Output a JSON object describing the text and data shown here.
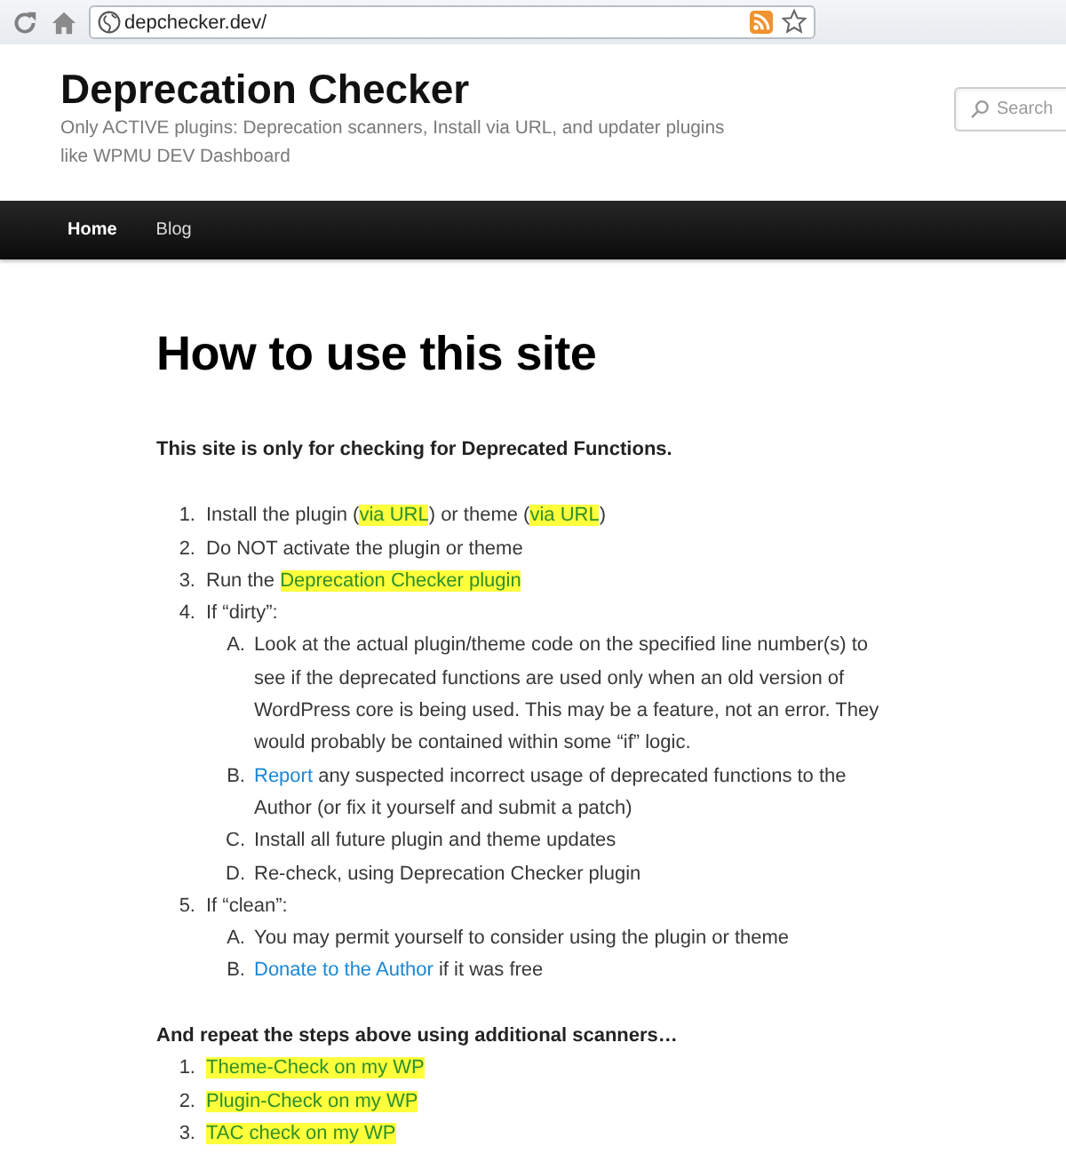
{
  "browser": {
    "url": "depchecker.dev/"
  },
  "header": {
    "site_title": "Deprecation Checker",
    "tagline": "Only ACTIVE plugins: Deprecation scanners, Install via URL, and updater plugins like WPMU DEV Dashboard",
    "search": {
      "placeholder": "Search"
    }
  },
  "nav": [
    {
      "label": "Home",
      "selected": true
    },
    {
      "label": "Blog",
      "selected": false
    }
  ],
  "article": {
    "title": "How to use this site",
    "intro": "This site is only for checking for Deprecated Functions.",
    "steps": [
      {
        "marker": "1.",
        "parts": [
          {
            "kind": "text",
            "text": "Install the plugin ("
          },
          {
            "kind": "highlighted-link",
            "text": "via URL"
          },
          {
            "kind": "text",
            "text": ") or theme ("
          },
          {
            "kind": "highlighted-link",
            "text": "via URL"
          },
          {
            "kind": "text",
            "text": ")"
          }
        ]
      },
      {
        "marker": "2.",
        "parts": [
          {
            "kind": "text",
            "text": "Do NOT activate the plugin or theme"
          }
        ]
      },
      {
        "marker": "3.",
        "parts": [
          {
            "kind": "text",
            "text": "Run the "
          },
          {
            "kind": "highlighted-link",
            "text": "Deprecation Checker plugin"
          }
        ]
      },
      {
        "marker": "4.",
        "parts": [
          {
            "kind": "text",
            "text": "If “dirty”:"
          }
        ],
        "children": [
          {
            "marker": "A.",
            "parts": [
              {
                "kind": "text",
                "text": "Look at the actual plugin/theme code on the specified line number(s) to see if the deprecated functions are used only when an old version of WordPress core is being used. This may be a feature, not an error. They would probably be contained within some “if” logic."
              }
            ]
          },
          {
            "marker": "B.",
            "parts": [
              {
                "kind": "link",
                "text": "Report"
              },
              {
                "kind": "text",
                "text": " any suspected incorrect usage of deprecated functions to the Author (or fix it yourself and submit a patch)"
              }
            ]
          },
          {
            "marker": "C.",
            "parts": [
              {
                "kind": "text",
                "text": "Install all future plugin and theme updates"
              }
            ]
          },
          {
            "marker": "D.",
            "parts": [
              {
                "kind": "text",
                "text": "Re-check, using Deprecation Checker plugin"
              }
            ]
          }
        ]
      },
      {
        "marker": "5.",
        "parts": [
          {
            "kind": "text",
            "text": "If “clean”:"
          }
        ],
        "children": [
          {
            "marker": "A.",
            "parts": [
              {
                "kind": "text",
                "text": "You may permit yourself to consider using the plugin or theme"
              }
            ]
          },
          {
            "marker": "B.",
            "parts": [
              {
                "kind": "link",
                "text": "Donate to the Author"
              },
              {
                "kind": "text",
                "text": " if it was free"
              }
            ]
          }
        ]
      }
    ],
    "more_heading": "And repeat the steps above using additional scanners…",
    "scanners": [
      {
        "marker": "1.",
        "parts": [
          {
            "kind": "highlighted-link",
            "text": "Theme-Check on my WP"
          }
        ]
      },
      {
        "marker": "2.",
        "parts": [
          {
            "kind": "highlighted-link",
            "text": "Plugin-Check on my WP"
          }
        ]
      },
      {
        "marker": "3.",
        "parts": [
          {
            "kind": "highlighted-link",
            "text": "TAC check on my WP"
          }
        ]
      }
    ]
  }
}
